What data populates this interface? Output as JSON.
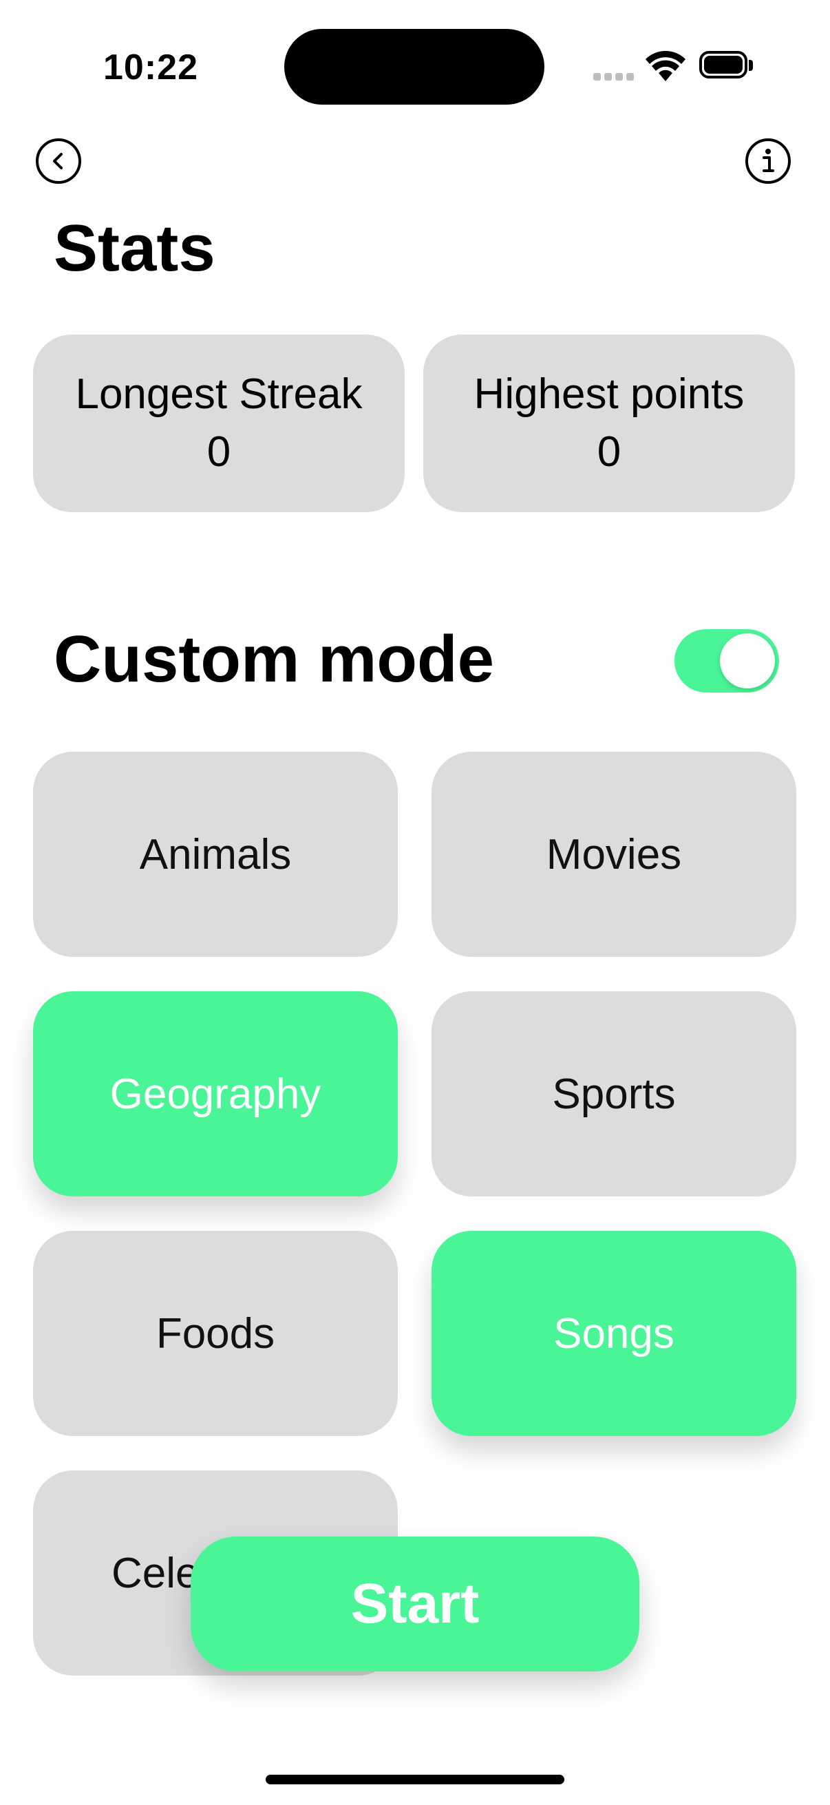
{
  "status_bar": {
    "time": "10:22"
  },
  "nav": {
    "back_icon": "chevron-left-circle-icon",
    "info_icon": "info-circle-icon"
  },
  "stats": {
    "title": "Stats",
    "cards": [
      {
        "label": "Longest Streak",
        "value": "0"
      },
      {
        "label": "Highest points",
        "value": "0"
      }
    ]
  },
  "custom_mode": {
    "title": "Custom mode",
    "enabled": true,
    "categories": [
      {
        "label": "Animals",
        "selected": false
      },
      {
        "label": "Movies",
        "selected": false
      },
      {
        "label": "Geography",
        "selected": true
      },
      {
        "label": "Sports",
        "selected": false
      },
      {
        "label": "Foods",
        "selected": false
      },
      {
        "label": "Songs",
        "selected": true
      },
      {
        "label": "Cele",
        "selected": false
      }
    ]
  },
  "start_button": {
    "label": "Start"
  },
  "colors": {
    "accent": "#4af597",
    "card": "#dcdcde"
  }
}
